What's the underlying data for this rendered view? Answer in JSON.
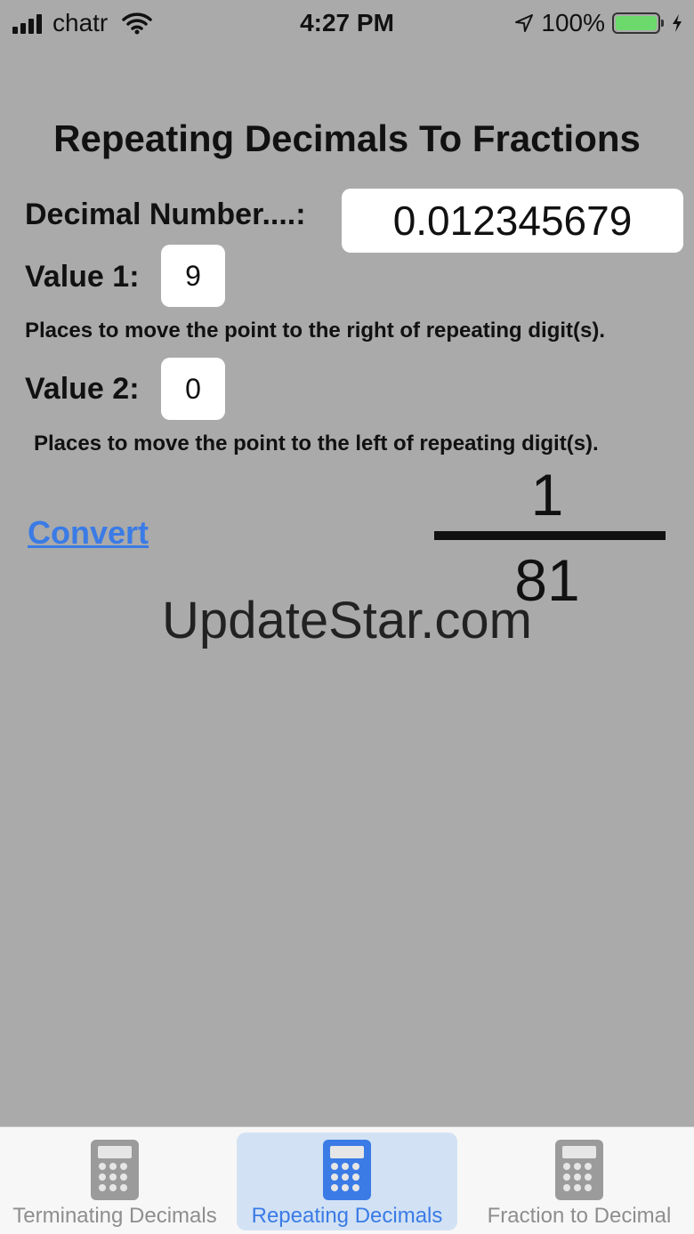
{
  "status_bar": {
    "carrier": "chatr",
    "time": "4:27 PM",
    "battery_percent": "100%",
    "battery_level": 1.0,
    "battery_color": "#6bd96b"
  },
  "page": {
    "title": "Repeating Decimals To Fractions"
  },
  "form": {
    "decimal_label": "Decimal Number....:",
    "decimal_value": "0.012345679",
    "value1_label": "Value 1:",
    "value1_value": "9",
    "value1_hint": "Places to move the point to the right of repeating digit(s).",
    "value2_label": "Value 2:",
    "value2_value": "0",
    "value2_hint": "Places to move the point to the left of repeating digit(s).",
    "convert_label": "Convert"
  },
  "result": {
    "numerator": "1",
    "denominator": "81"
  },
  "watermark": "UpdateStar.com",
  "tabs": [
    {
      "label": "Terminating Decimals",
      "icon": "calculator-icon",
      "selected": false
    },
    {
      "label": "Repeating Decimals",
      "icon": "calculator-icon",
      "selected": true
    },
    {
      "label": "Fraction to Decimal",
      "icon": "calculator-icon",
      "selected": false
    }
  ],
  "colors": {
    "background": "#aaaaaa",
    "accent": "#3a7be6",
    "tab_inactive": "#8e8e8e"
  }
}
